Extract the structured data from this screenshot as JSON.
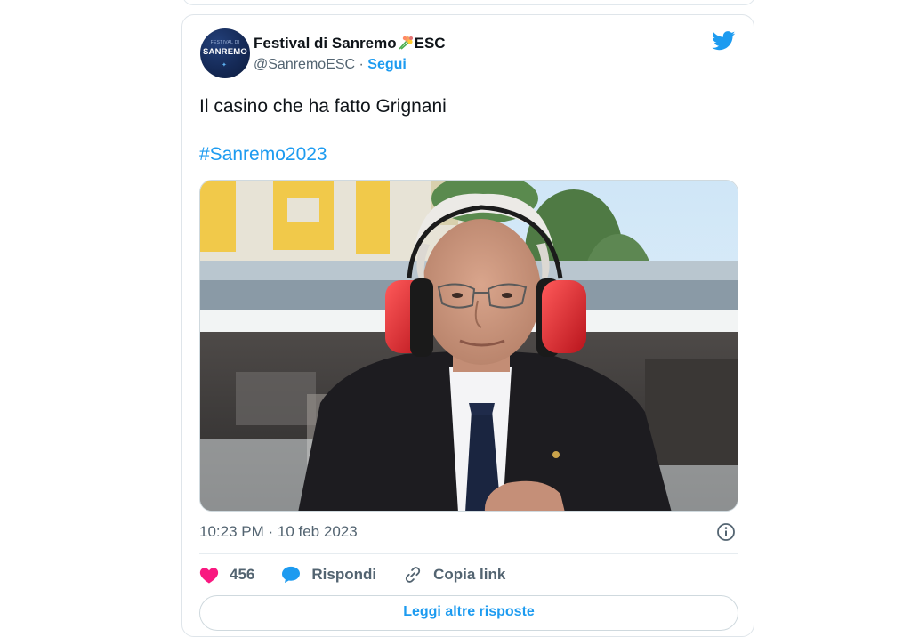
{
  "tweet": {
    "author_name": "Festival di Sanremo",
    "author_suffix": "ESC",
    "handle": "@SanremoESC",
    "separator": " · ",
    "follow_label": "Segui",
    "avatar_small_text": "FESTIVAL DI",
    "avatar_text": "SANREMO",
    "text": "Il casino che ha fatto Grignani",
    "hashtag": "#Sanremo2023",
    "timestamp": "10:23 PM · 10 feb 2023",
    "likes": "456",
    "reply_label": "Rispondi",
    "copy_link_label": "Copia link",
    "bottom_button_label": "Leggi altre risposte"
  },
  "icons": {
    "brand": "twitter-bird-icon",
    "like": "heart-icon",
    "reply": "speech-bubble-icon",
    "copy": "link-icon",
    "info": "info-icon",
    "flower": "bouquet-icon"
  },
  "colors": {
    "twitter_blue": "#1d9bf0",
    "like_pink": "#f91880",
    "text": "#0f1419",
    "muted": "#536471"
  }
}
